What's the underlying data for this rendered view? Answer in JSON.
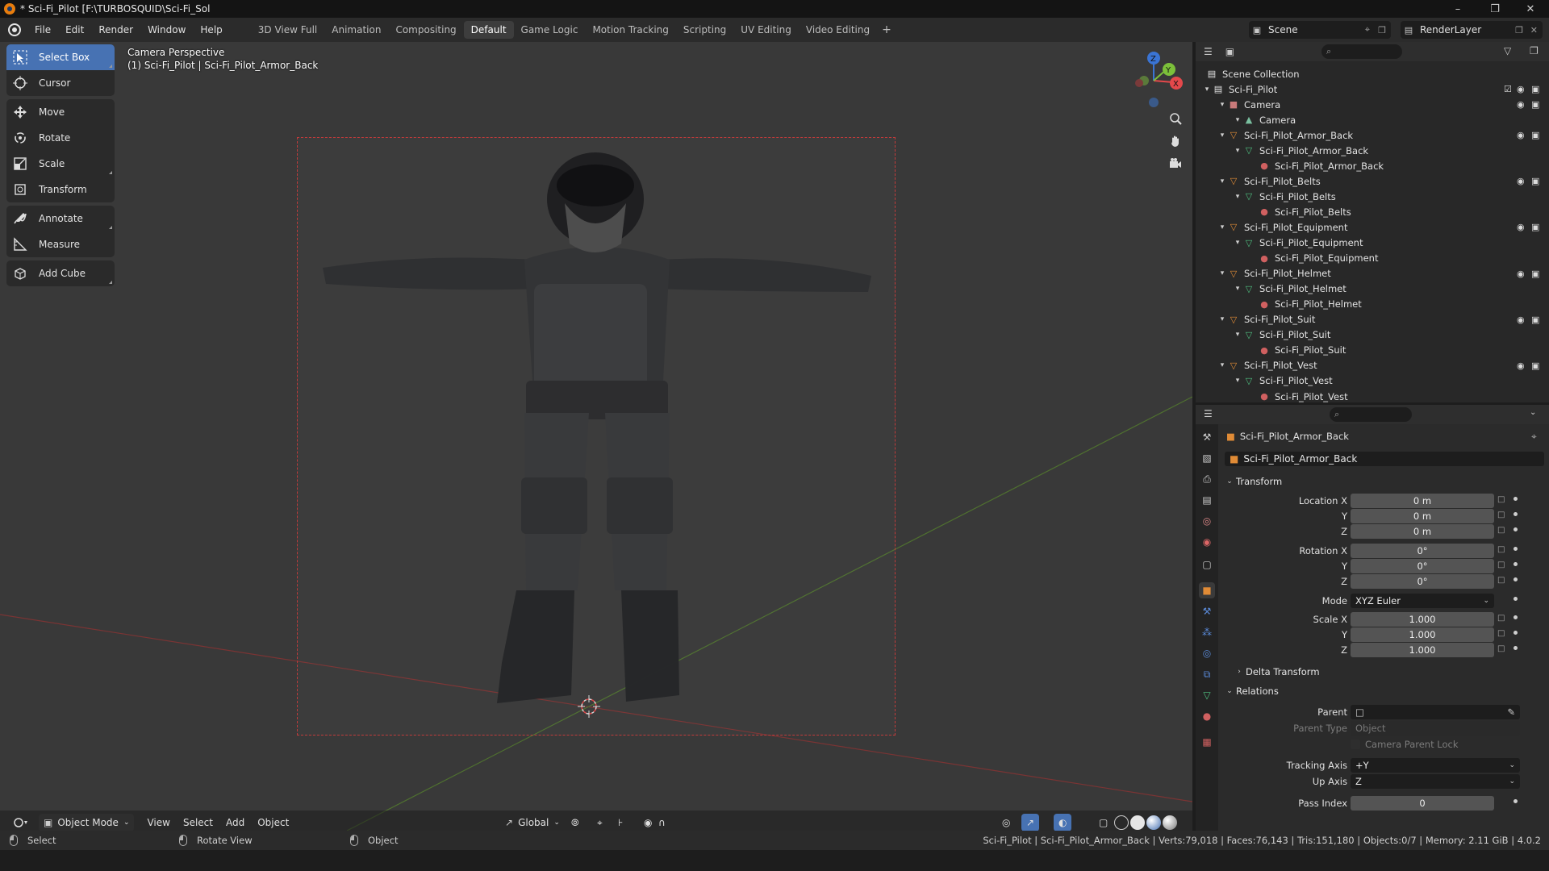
{
  "window": {
    "title": "* Sci-Fi_Pilot [F:\\TURBOSQUID\\Sci-Fi_Sol"
  },
  "menu": {
    "items": [
      "File",
      "Edit",
      "Render",
      "Window",
      "Help"
    ]
  },
  "workspaces": {
    "tabs": [
      "3D View Full",
      "Animation",
      "Compositing",
      "Default",
      "Game Logic",
      "Motion Tracking",
      "Scripting",
      "UV Editing",
      "Video Editing"
    ],
    "active": "Default"
  },
  "scene": {
    "name": "Scene"
  },
  "render_layer": {
    "name": "RenderLayer"
  },
  "viewport": {
    "perspective_label": "Camera Perspective",
    "object_label": "(1) Sci-Fi_Pilot | Sci-Fi_Pilot_Armor_Back",
    "gizmo_axes": {
      "z": "Z",
      "y": "Y",
      "x": "X"
    }
  },
  "toolbar": {
    "tools": [
      "Select Box",
      "Cursor",
      "Move",
      "Rotate",
      "Scale",
      "Transform",
      "Annotate",
      "Measure",
      "Add Cube"
    ],
    "active": "Select Box"
  },
  "viewport_header": {
    "mode": "Object Mode",
    "menus": [
      "View",
      "Select",
      "Add",
      "Object"
    ],
    "orientation": "Global"
  },
  "statusbar": {
    "select": "Select",
    "rotate_view": "Rotate View",
    "object": "Object",
    "stats": "Sci-Fi_Pilot | Sci-Fi_Pilot_Armor_Back | Verts:79,018 | Faces:76,143 | Tris:151,180 | Objects:0/7 | Memory: 2.11 GiB | 4.0.2"
  },
  "outliner": {
    "root": "Scene Collection",
    "rows": [
      {
        "label": "Sci-Fi_Pilot",
        "type": "collection",
        "depth": 1
      },
      {
        "label": "Camera",
        "type": "camera",
        "depth": 2
      },
      {
        "label": "Camera",
        "type": "camdata",
        "depth": 3
      },
      {
        "label": "Sci-Fi_Pilot_Armor_Back",
        "type": "object",
        "depth": 2
      },
      {
        "label": "Sci-Fi_Pilot_Armor_Back",
        "type": "mesh",
        "depth": 3
      },
      {
        "label": "Sci-Fi_Pilot_Armor_Back",
        "type": "material",
        "depth": 4
      },
      {
        "label": "Sci-Fi_Pilot_Belts",
        "type": "object",
        "depth": 2
      },
      {
        "label": "Sci-Fi_Pilot_Belts",
        "type": "mesh",
        "depth": 3
      },
      {
        "label": "Sci-Fi_Pilot_Belts",
        "type": "material",
        "depth": 4
      },
      {
        "label": "Sci-Fi_Pilot_Equipment",
        "type": "object",
        "depth": 2
      },
      {
        "label": "Sci-Fi_Pilot_Equipment",
        "type": "mesh",
        "depth": 3
      },
      {
        "label": "Sci-Fi_Pilot_Equipment",
        "type": "material",
        "depth": 4
      },
      {
        "label": "Sci-Fi_Pilot_Helmet",
        "type": "object",
        "depth": 2
      },
      {
        "label": "Sci-Fi_Pilot_Helmet",
        "type": "mesh",
        "depth": 3
      },
      {
        "label": "Sci-Fi_Pilot_Helmet",
        "type": "material",
        "depth": 4
      },
      {
        "label": "Sci-Fi_Pilot_Suit",
        "type": "object",
        "depth": 2
      },
      {
        "label": "Sci-Fi_Pilot_Suit",
        "type": "mesh",
        "depth": 3
      },
      {
        "label": "Sci-Fi_Pilot_Suit",
        "type": "material",
        "depth": 4
      },
      {
        "label": "Sci-Fi_Pilot_Vest",
        "type": "object",
        "depth": 2
      },
      {
        "label": "Sci-Fi_Pilot_Vest",
        "type": "mesh",
        "depth": 3
      },
      {
        "label": "Sci-Fi_Pilot_Vest",
        "type": "material",
        "depth": 4
      }
    ]
  },
  "properties": {
    "breadcrumb": "Sci-Fi_Pilot_Armor_Back",
    "object_name": "Sci-Fi_Pilot_Armor_Back",
    "transform": {
      "title": "Transform",
      "location_x_label": "Location X",
      "location_x": "0 m",
      "y_label": "Y",
      "location_y": "0 m",
      "z_label": "Z",
      "location_z": "0 m",
      "rotation_x_label": "Rotation X",
      "rotation_x": "0°",
      "rotation_y": "0°",
      "rotation_z": "0°",
      "mode_label": "Mode",
      "mode": "XYZ Euler",
      "scale_x_label": "Scale X",
      "scale_x": "1.000",
      "scale_y": "1.000",
      "scale_z": "1.000"
    },
    "delta_transform": {
      "title": "Delta Transform"
    },
    "relations": {
      "title": "Relations",
      "parent_label": "Parent",
      "parent": "",
      "parent_type_label": "Parent Type",
      "parent_type": "Object",
      "camera_parent_lock": "Camera Parent Lock",
      "tracking_axis_label": "Tracking Axis",
      "tracking_axis": "+Y",
      "up_axis_label": "Up Axis",
      "up_axis": "Z",
      "pass_index_label": "Pass Index",
      "pass_index": "0"
    }
  },
  "colors": {
    "accent": "#4772b3",
    "object_orange": "#e08b36",
    "mesh_green": "#4fc080",
    "material_red": "#d06060",
    "axis_x": "#e4484b",
    "axis_y": "#7cc03a",
    "axis_z": "#3a74d4"
  }
}
